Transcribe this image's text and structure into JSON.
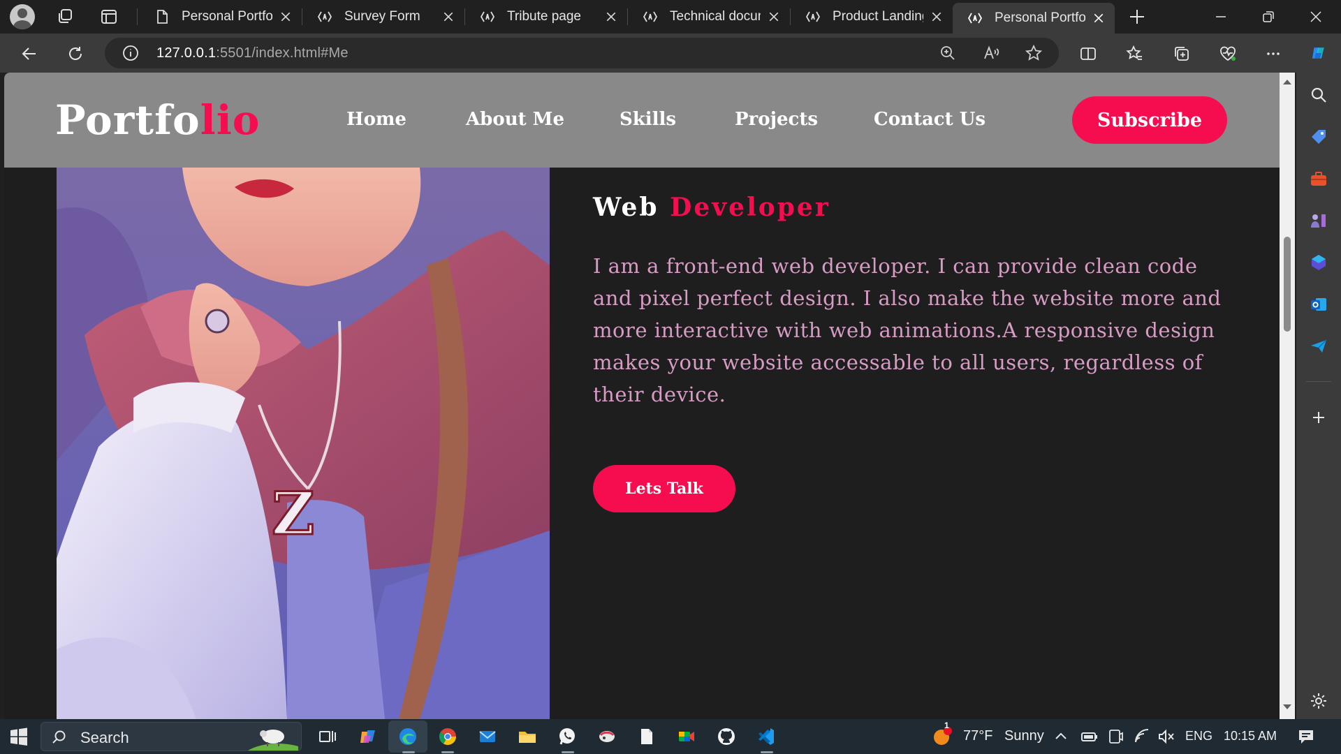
{
  "browser": {
    "tabs": [
      {
        "title": "Personal Portfolio",
        "favicon": "page-icon",
        "active": false
      },
      {
        "title": "Survey Form",
        "favicon": "fcc-icon",
        "active": false
      },
      {
        "title": "Tribute page",
        "favicon": "fcc-icon",
        "active": false
      },
      {
        "title": "Technical document",
        "favicon": "fcc-icon",
        "active": false
      },
      {
        "title": "Product Landing",
        "favicon": "fcc-icon",
        "active": false
      },
      {
        "title": "Personal Portfolio",
        "favicon": "fcc-icon",
        "active": true
      }
    ],
    "address": {
      "host": "127.0.0.1",
      "rest": ":5501/index.html#Me"
    }
  },
  "page": {
    "logo": {
      "main": "Portfo",
      "accent": "lio"
    },
    "nav": [
      "Home",
      "About Me",
      "Skills",
      "Projects",
      "Contact Us"
    ],
    "subscribe_label": "Subscribe",
    "hero": {
      "title_main": "Web",
      "title_accent": "Developer",
      "text": "I am a front-end web developer. I can provide clean code and pixel perfect design. I also make the website more and more interactive with web animations.A responsive design makes your website accessable to all users, regardless of their device.",
      "cta_label": "Lets Talk"
    },
    "accent_color": "#f60d4f"
  },
  "taskbar": {
    "search_label": "Search",
    "weather": {
      "temp": "77°F",
      "condition": "Sunny",
      "badge": "1"
    },
    "language": "ENG",
    "time": "10:15 AM"
  }
}
